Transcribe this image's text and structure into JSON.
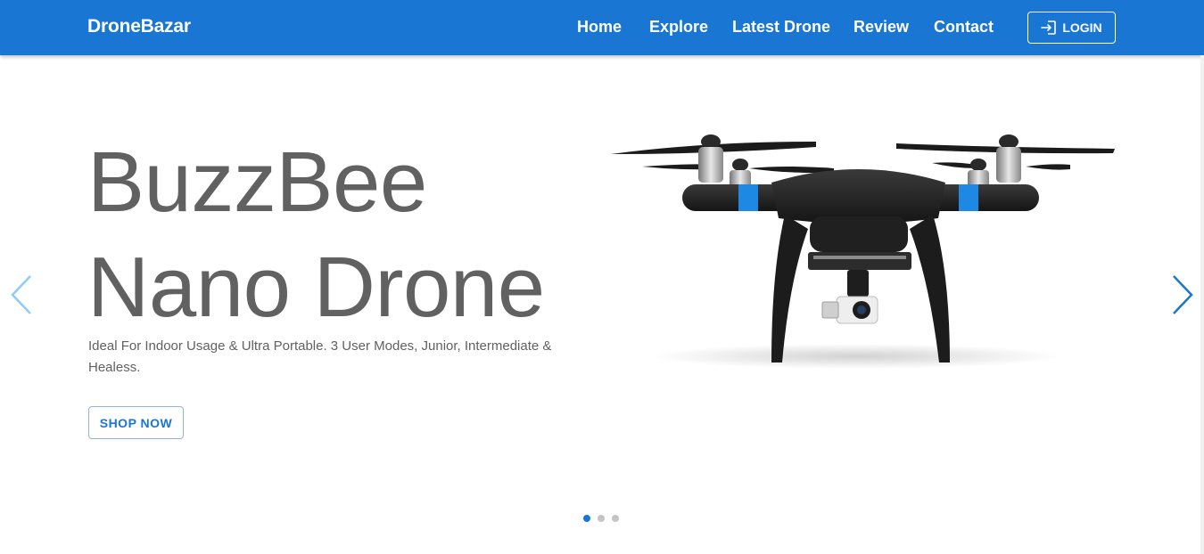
{
  "navbar": {
    "brand": "DroneBazar",
    "links": [
      {
        "label": "Home"
      },
      {
        "label": "Explore"
      },
      {
        "label": "Latest Drone"
      },
      {
        "label": "Review"
      },
      {
        "label": "Contact"
      }
    ],
    "login_label": "LOGIN",
    "login_icon": "login-icon"
  },
  "hero": {
    "title_line1": "BuzzBee",
    "title_line2": "Nano Drone",
    "description": "Ideal For Indoor Usage & Ultra Portable. 3 User Modes, Junior, Intermediate & Healess.",
    "cta_label": "SHOP NOW",
    "image": "drone-image"
  },
  "carousel": {
    "prev_icon": "chevron-left-icon",
    "next_icon": "chevron-right-icon",
    "slide_count": 3,
    "active_index": 0
  },
  "colors": {
    "primary": "#1976d2",
    "text": "#616161",
    "dot_inactive": "#c4c4c4"
  }
}
